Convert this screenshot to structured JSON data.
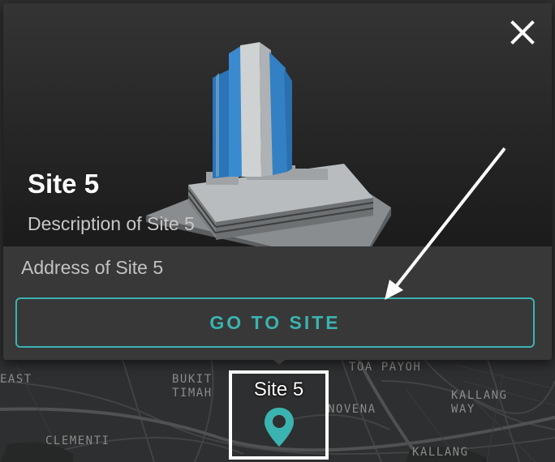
{
  "popup": {
    "title": "Site 5",
    "description": "Description of Site 5",
    "address": "Address of Site 5",
    "button_label": "GO TO SITE",
    "close_icon": "close-icon"
  },
  "marker": {
    "label": "Site 5",
    "icon": "map-pin-icon",
    "color": "#3bb3b0"
  },
  "map": {
    "labels": {
      "east": "EAST",
      "bukit_timah": "BUKIT\nTIMAH",
      "toa_payoh": "TOA PAYOH",
      "novena": "NOVENA",
      "kallang_way": "KALLANG\nWAY",
      "clementi": "CLEMENTI",
      "kallang": "KALLANG"
    }
  },
  "colors": {
    "accent": "#3bb3b0",
    "card": "#383838",
    "map_bg": "#2e2f30"
  }
}
